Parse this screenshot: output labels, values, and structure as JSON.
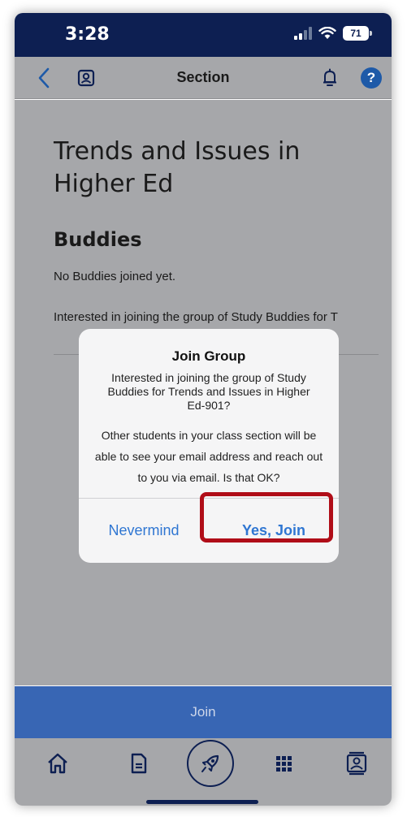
{
  "status_bar": {
    "time": "3:28",
    "battery": "71"
  },
  "nav": {
    "title": "Section"
  },
  "content": {
    "course_title": "Trends and Issues in Higher Ed",
    "section_heading": "Buddies",
    "no_buddies": "No Buddies joined yet.",
    "interest_text": "Interested in joining the group of Study Buddies for T"
  },
  "dialog": {
    "title": "Join Group",
    "message": "Interested in joining the group of Study Buddies for Trends and Issues in Higher Ed-901?",
    "note": "Other students in your class section will be able to see your email address and reach out to you via email. Is that OK?",
    "cancel_label": "Nevermind",
    "confirm_label": "Yes, Join"
  },
  "join_bar": {
    "label": "Join"
  },
  "colors": {
    "status_bar": "#0d1f52",
    "overlay_gray": "#a6a7aa",
    "accent_blue": "#2f76d2",
    "join_bar": "#3866b4",
    "highlight_red": "#b00d18"
  },
  "icons": {
    "nav": [
      "chevron-left-icon",
      "profile-icon",
      "bell-icon",
      "help-icon"
    ],
    "tabs": [
      "home-icon",
      "document-icon",
      "rocket-icon",
      "apps-grid-icon",
      "profile-card-icon"
    ]
  }
}
